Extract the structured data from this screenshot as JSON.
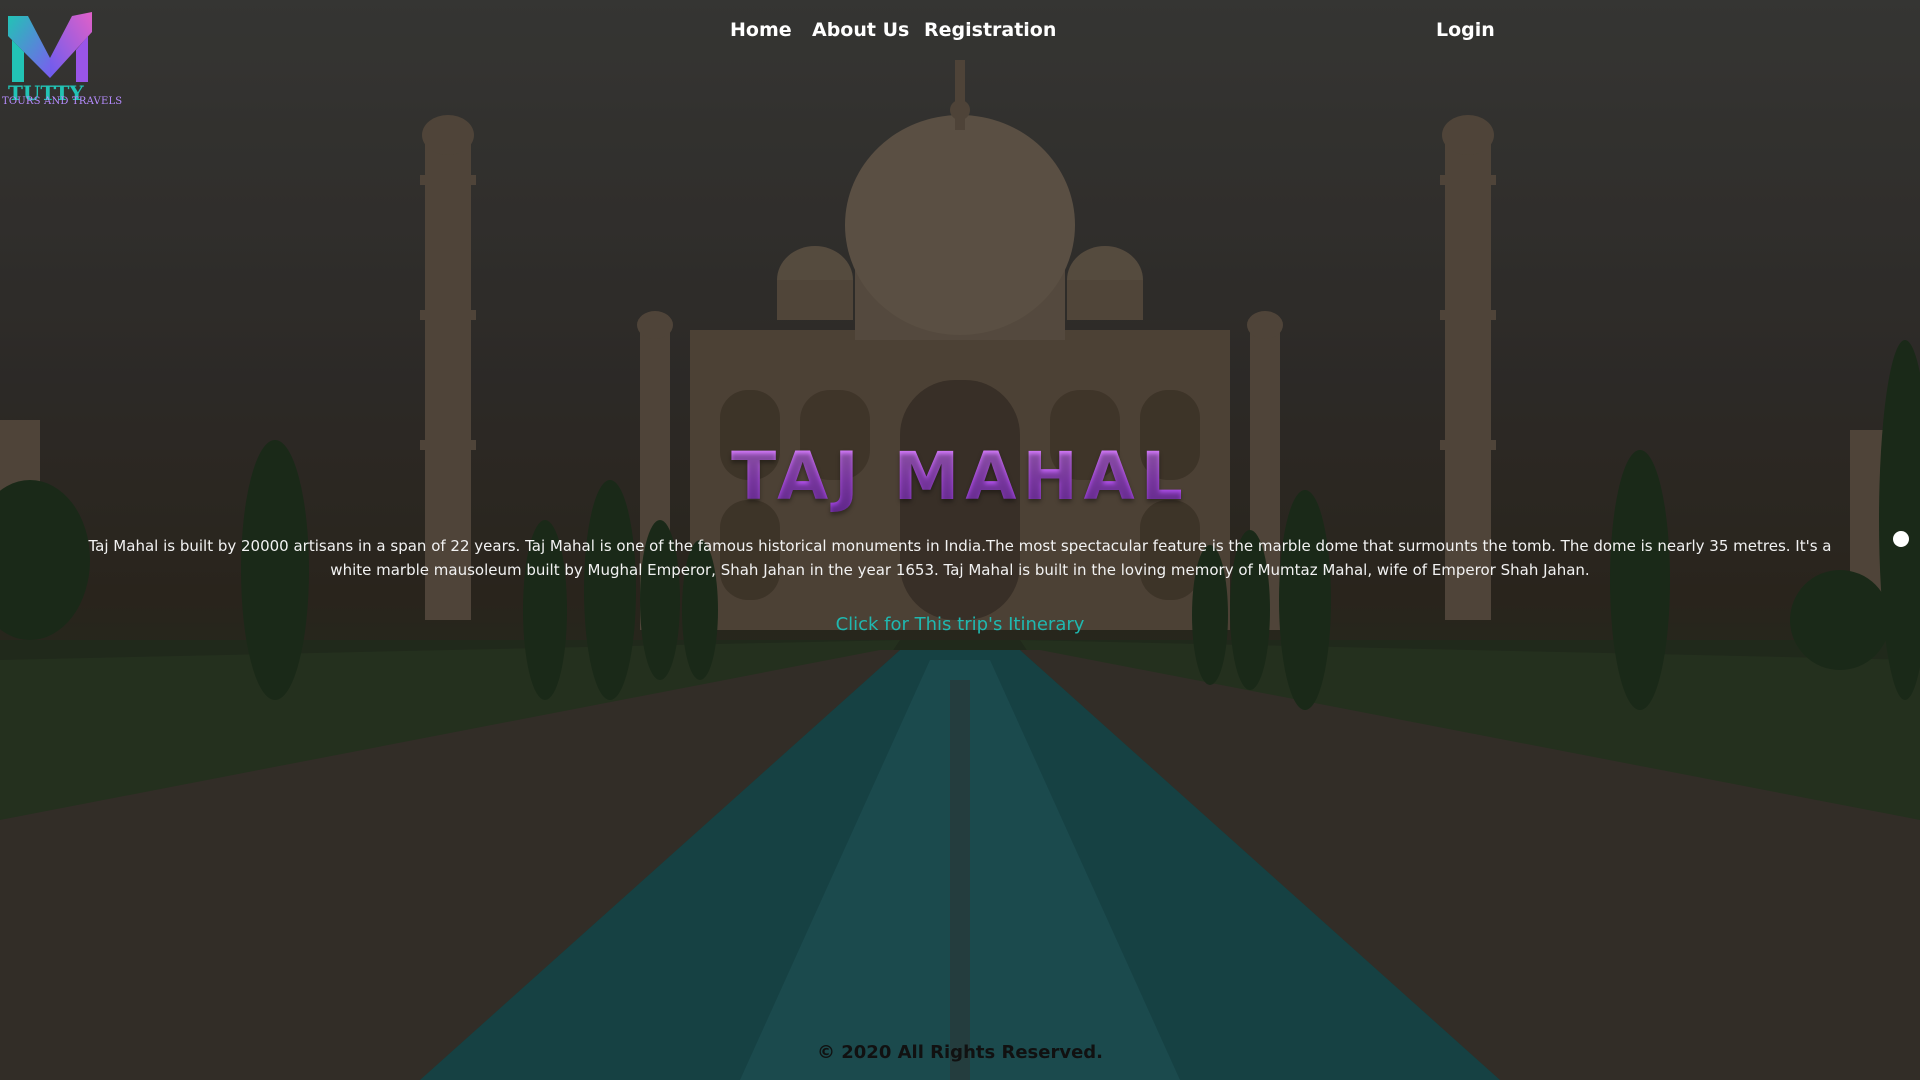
{
  "brand": {
    "logo_text": "TOURS AND TRAVELS",
    "colors": {
      "teal": "#1fb8b0",
      "purple": "#b653f0",
      "pink": "#e060c8"
    }
  },
  "nav": {
    "home": "Home",
    "about": "About Us",
    "registration": "Registration",
    "login": "Login"
  },
  "hero": {
    "title": "TAJ MAHAL",
    "description": "Taj Mahal is built by 20000 artisans in a span of 22 years. Taj Mahal is one of the famous historical monuments in India.The most spectacular feature is the marble dome that surmounts the tomb. The dome is nearly 35 metres. It's a white marble mausoleum built by Mughal Emperor, Shah Jahan in the year 1653. Taj Mahal is built in the loving memory of Mumtaz Mahal, wife of Emperor Shah Jahan.",
    "link_text": "Click for This trip's Itinerary",
    "title_color": "#c06cff",
    "link_color": "#1fb8b0"
  },
  "footer": {
    "copyright": "© 2020 All Rights Reserved."
  }
}
